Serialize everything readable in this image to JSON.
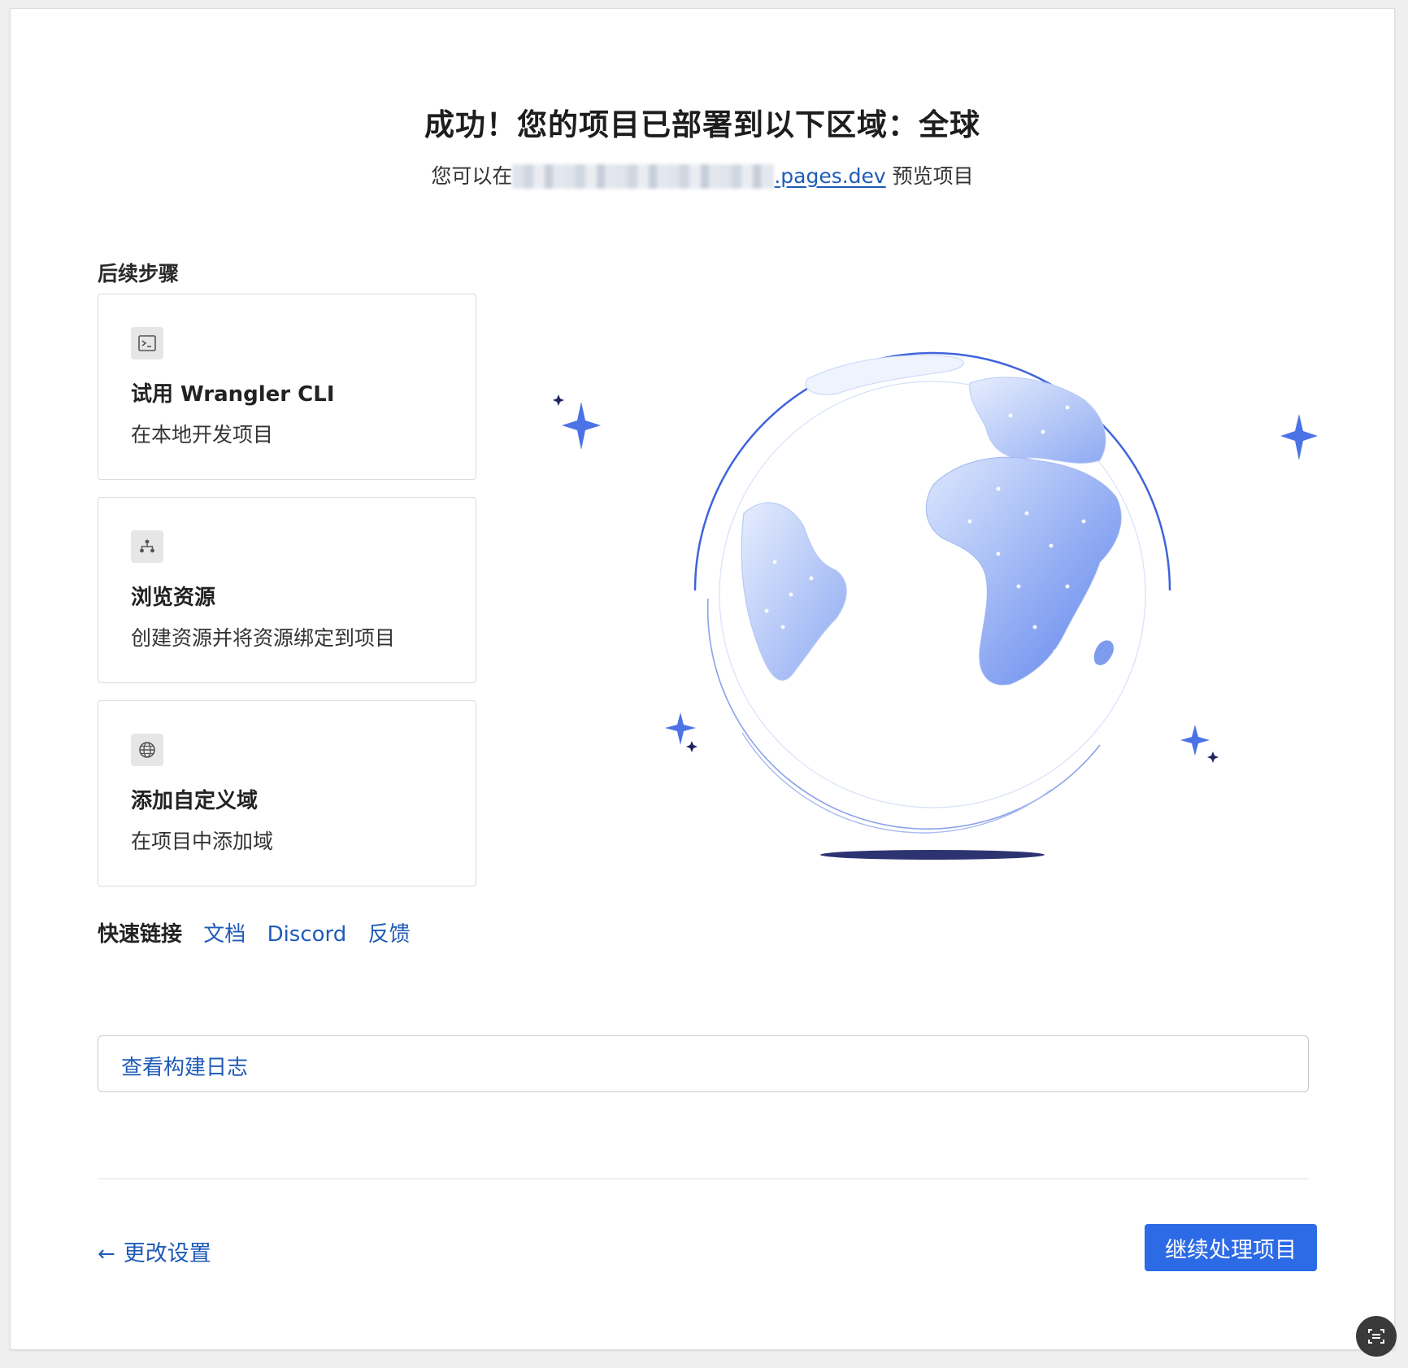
{
  "header": {
    "title": "成功！您的项目已部署到以下区域：全球",
    "subtitle_prefix": "您可以在",
    "subtitle_link": ".pages.dev",
    "subtitle_suffix": " 预览项目"
  },
  "next_steps": {
    "label": "后续步骤",
    "cards": [
      {
        "title": "试用 Wrangler CLI",
        "description": "在本地开发项目",
        "icon": "terminal-icon"
      },
      {
        "title": "浏览资源",
        "description": "创建资源并将资源绑定到项目",
        "icon": "network-icon"
      },
      {
        "title": "添加自定义域",
        "description": "在项目中添加域",
        "icon": "globe-icon"
      }
    ]
  },
  "quick_links": {
    "label": "快速链接",
    "links": [
      "文档",
      "Discord",
      "反馈"
    ]
  },
  "build_log": {
    "label": "查看构建日志"
  },
  "footer": {
    "back_label": "更改设置",
    "continue_label": "继续处理项目"
  },
  "colors": {
    "accent": "#2c6ae6",
    "link": "#1f5bb8",
    "globe_dark": "#4b73e6",
    "globe_light": "#c8d8fb",
    "shadow": "#2d3370"
  }
}
